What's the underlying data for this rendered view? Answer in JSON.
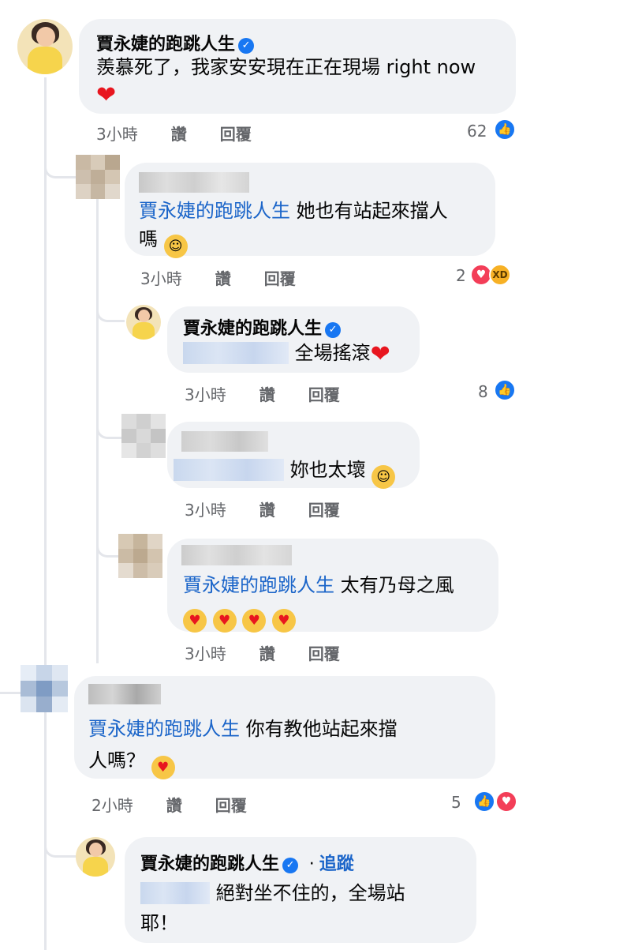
{
  "comments": [
    {
      "author": "賈永婕的跑跳人生",
      "verified": true,
      "text": "羨慕死了，我家安安現在正在現場 right now",
      "time": "3小時",
      "like_label": "讚",
      "reply_label": "回覆",
      "reaction_count": "62",
      "reactions": [
        "like-icon"
      ]
    },
    {
      "author": "",
      "mention": "賈永婕的跑跳人生",
      "text_line1": "她也有站起來擋人",
      "text_line2": "嗎",
      "time": "3小時",
      "like_label": "讚",
      "reply_label": "回覆",
      "reaction_count": "2",
      "reactions": [
        "love-icon",
        "haha-icon"
      ]
    },
    {
      "author": "賈永婕的跑跳人生",
      "verified": true,
      "text": "全場搖滾",
      "time": "3小時",
      "like_label": "讚",
      "reply_label": "回覆",
      "reaction_count": "8",
      "reactions": [
        "like-icon"
      ]
    },
    {
      "author": "",
      "text": "妳也太壞",
      "time": "3小時",
      "like_label": "讚",
      "reply_label": "回覆"
    },
    {
      "author": "",
      "mention": "賈永婕的跑跳人生",
      "text": "太有乃母之風",
      "time": "3小時",
      "like_label": "讚",
      "reply_label": "回覆"
    },
    {
      "author": "",
      "mention": "賈永婕的跑跳人生",
      "text_line1": "你有教他站起來擋",
      "text_line2": "人嗎？",
      "time": "2小時",
      "like_label": "讚",
      "reply_label": "回覆",
      "reaction_count": "5",
      "reactions": [
        "like-icon",
        "love-icon"
      ]
    },
    {
      "author": "賈永婕的跑跳人生",
      "verified": true,
      "follow_sep": "·",
      "follow_label": "追蹤",
      "text_line1": "絕對坐不住的，全場站",
      "text_line2": "耶！"
    }
  ],
  "colors": {
    "mention": "#1b65c9",
    "bubble": "#f0f2f5",
    "meta": "#65676b",
    "like": "#1877f2",
    "love": "#f33e58"
  }
}
